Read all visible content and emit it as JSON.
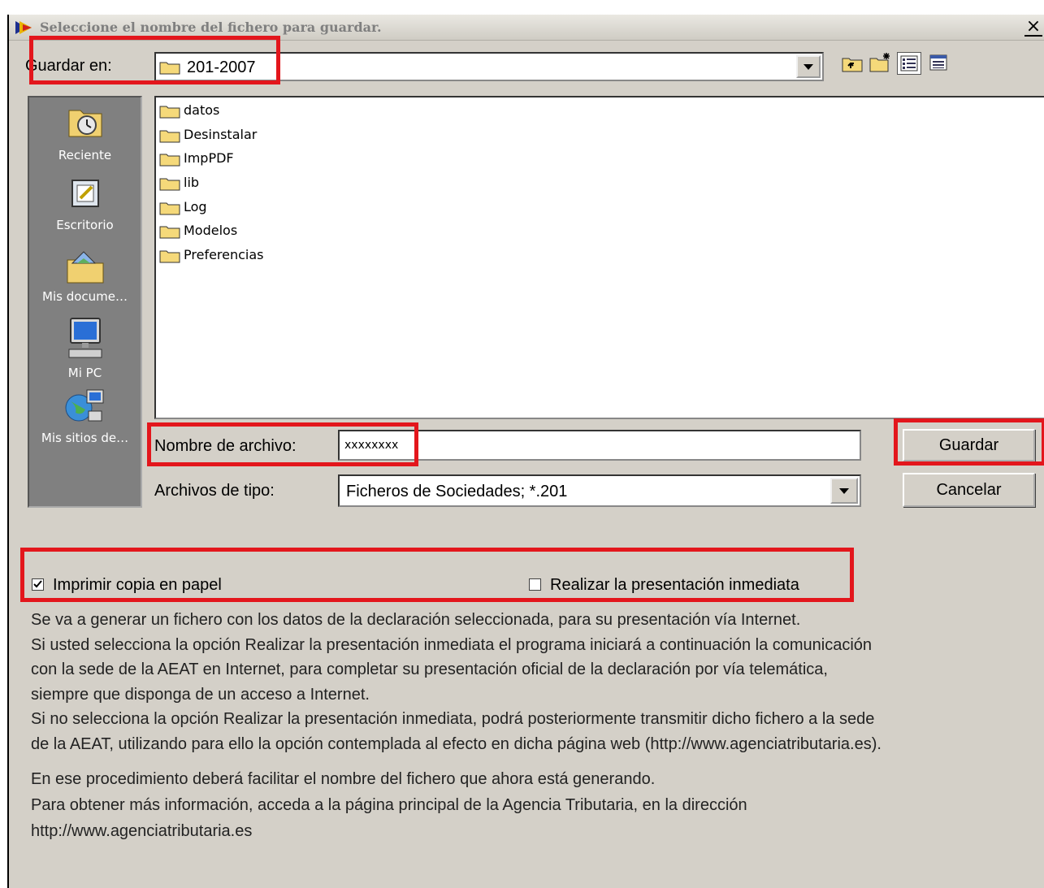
{
  "window": {
    "title": "Seleccione el nombre del fichero para guardar.",
    "close_label": "×"
  },
  "save_in": {
    "label": "Guardar en:",
    "value": "201-2007"
  },
  "toolbar": {
    "icons": [
      "up-folder-icon",
      "new-folder-icon",
      "list-view-icon",
      "details-view-icon"
    ]
  },
  "places": [
    {
      "label": "Reciente",
      "icon": "recent-icon"
    },
    {
      "label": "Escritorio",
      "icon": "desktop-icon"
    },
    {
      "label": "Mis docume…",
      "icon": "my-documents-icon"
    },
    {
      "label": "Mi PC",
      "icon": "my-computer-icon"
    },
    {
      "label": "Mis sitios de…",
      "icon": "network-places-icon"
    }
  ],
  "files": [
    "datos",
    "Desinstalar",
    "ImpPDF",
    "lib",
    "Log",
    "Modelos",
    "Preferencias"
  ],
  "filename": {
    "label": "Nombre de archivo:",
    "value": "xxxxxxxx"
  },
  "filetype": {
    "label": "Archivos de tipo:",
    "value": "Ficheros de Sociedades; *.201"
  },
  "buttons": {
    "save": "Guardar",
    "cancel": "Cancelar"
  },
  "options": {
    "print_copy": {
      "label": "Imprimir copia en papel",
      "checked": true
    },
    "immediate_submission": {
      "label": "Realizar la presentación inmediata",
      "checked": false
    }
  },
  "info_lines": [
    "Se va a generar un fichero con los datos de la declaración seleccionada, para su presentación vía Internet.",
    "Si usted selecciona la opción Realizar la presentación inmediata el programa iniciará a continuación la comunicación",
    "con la sede de la AEAT en Internet, para completar su presentación oficial de la declaración por vía telemática,",
    "siempre que disponga de un acceso a Internet.",
    "Si no selecciona la opción Realizar la presentación inmediata, podrá posteriormente transmitir dicho fichero  a la sede",
    "de la AEAT, utilizando para ello la opción contemplada al efecto en dicha página web (http://www.agenciatributaria.es)."
  ],
  "info_lines_2": [
    "En ese procedimiento deberá facilitar el nombre del fichero que ahora está generando.",
    "Para obtener más información, acceda a la página principal de la Agencia Tributaria, en la dirección",
    "http://www.agenciatributaria.es"
  ],
  "colors": {
    "highlight": "#e3161c",
    "dialog_bg": "#d4d0c8",
    "folder": "#f5d97a"
  }
}
